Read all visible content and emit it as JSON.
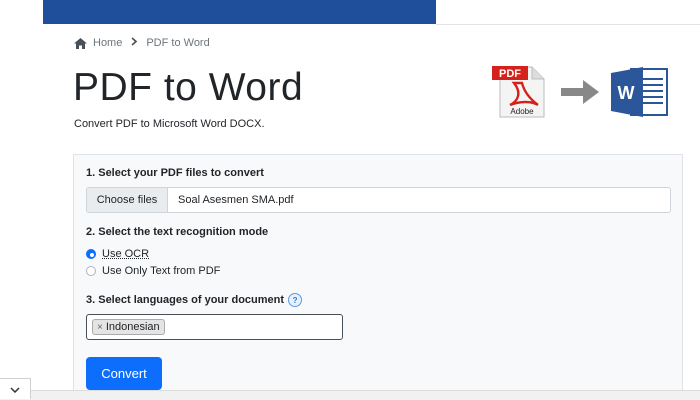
{
  "breadcrumb": {
    "home_label": "Home",
    "current_label": "PDF to Word"
  },
  "header": {
    "title": "PDF to Word",
    "subtitle": "Convert PDF to Microsoft Word DOCX."
  },
  "logos": {
    "pdf_text": "PDF",
    "adobe_text": "Adobe",
    "word_letter": "W"
  },
  "form": {
    "step1_label": "1. Select your PDF files to convert",
    "choose_files_label": "Choose files",
    "selected_file": "Soal Asesmen SMA.pdf",
    "step2_label": "2. Select the text recognition mode",
    "mode_options": [
      {
        "label": "Use OCR",
        "checked": true
      },
      {
        "label": "Use Only Text from PDF",
        "checked": false
      }
    ],
    "step3_label": "3. Select languages of your document",
    "help_icon_glyph": "?",
    "selected_languages": [
      "Indonesian"
    ],
    "tag_remove_glyph": "×",
    "convert_label": "Convert"
  },
  "colors": {
    "accent": "#0d6efd",
    "banner": "#1f4e9a",
    "word_blue": "#2b579a",
    "pdf_red": "#d4211c"
  },
  "icons": [
    "home-icon",
    "chevron-right-icon",
    "pdf-file-icon",
    "arrow-right-icon",
    "word-file-icon",
    "help-icon",
    "chevron-down-icon"
  ]
}
